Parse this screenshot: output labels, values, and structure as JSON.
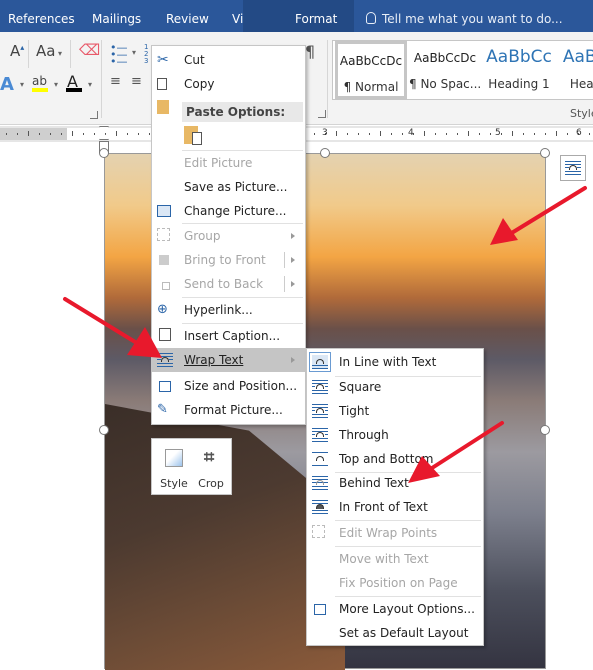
{
  "ribbon_tabs": [
    {
      "label": "References",
      "active": false
    },
    {
      "label": "Mailings",
      "active": false
    },
    {
      "label": "Review",
      "active": false
    },
    {
      "label": "View",
      "active": false
    },
    {
      "label": "Format",
      "active": true
    }
  ],
  "tell_me": {
    "placeholder": "Tell me what you want to do...",
    "icon": "lightbulb-icon"
  },
  "font_group": {
    "highlight_color": "#ffff00",
    "font_color": "#000000",
    "text_effects_label": "A",
    "change_case_label": "Aa",
    "grow_font_label": "A"
  },
  "styles": {
    "group_label": "Styles",
    "items": [
      {
        "sample": "AaBbCcDc",
        "name": "¶ Normal",
        "selected": true
      },
      {
        "sample": "AaBbCcDc",
        "name": "¶ No Spac...",
        "selected": false
      },
      {
        "sample": "AaBbCc",
        "name": "Heading 1",
        "selected": false
      },
      {
        "sample": "AaBbC",
        "name": "Headin",
        "selected": false
      }
    ]
  },
  "pilcrow": "¶",
  "ruler": {
    "numbers": [
      "3",
      "4",
      "5",
      "6"
    ]
  },
  "context_menu": {
    "items": [
      {
        "label": "Cut",
        "icon": "scissors-icon",
        "enabled": true
      },
      {
        "label": "Copy",
        "icon": "copy-icon",
        "enabled": true
      },
      {
        "label": "Paste Options:",
        "icon": "paste-icon",
        "header": true
      },
      {
        "label": "Edit Picture",
        "enabled": false
      },
      {
        "label": "Save as Picture...",
        "enabled": true
      },
      {
        "label": "Change Picture...",
        "icon": "change-picture-icon",
        "enabled": true
      },
      {
        "label": "Group",
        "icon": "group-icon",
        "enabled": false,
        "submenu": true
      },
      {
        "label": "Bring to Front",
        "icon": "bring-to-front-icon",
        "enabled": false,
        "submenu": true
      },
      {
        "label": "Send to Back",
        "icon": "send-to-back-icon",
        "enabled": false,
        "submenu": true
      },
      {
        "label": "Hyperlink...",
        "icon": "hyperlink-icon",
        "enabled": true
      },
      {
        "label": "Insert Caption...",
        "icon": "caption-icon",
        "enabled": true
      },
      {
        "label": "Wrap Text",
        "icon": "wrap-text-icon",
        "enabled": true,
        "submenu": true,
        "highlighted": true
      },
      {
        "label": "Size and Position...",
        "icon": "size-position-icon",
        "enabled": true
      },
      {
        "label": "Format Picture...",
        "icon": "format-picture-icon",
        "enabled": true
      }
    ]
  },
  "mini_toolbar": {
    "buttons": [
      {
        "label": "Style",
        "icon": "picture-style-icon"
      },
      {
        "label": "Crop",
        "icon": "crop-icon"
      }
    ]
  },
  "wrap_submenu": {
    "items": [
      {
        "label": "In Line with Text",
        "enabled": true,
        "checked": true
      },
      {
        "label": "Square",
        "enabled": true
      },
      {
        "label": "Tight",
        "enabled": true
      },
      {
        "label": "Through",
        "enabled": true
      },
      {
        "label": "Top and Bottom",
        "enabled": true
      },
      {
        "label": "Behind Text",
        "enabled": true
      },
      {
        "label": "In Front of Text",
        "enabled": true
      },
      {
        "label": "Edit Wrap Points",
        "enabled": false
      },
      {
        "label": "Move with Text",
        "enabled": false
      },
      {
        "label": "Fix Position on Page",
        "enabled": false
      },
      {
        "label": "More Layout Options...",
        "enabled": true
      },
      {
        "label": "Set as Default Layout",
        "enabled": true
      }
    ]
  },
  "annotation_color": "#e8192c",
  "accent_color": "#2b579a"
}
